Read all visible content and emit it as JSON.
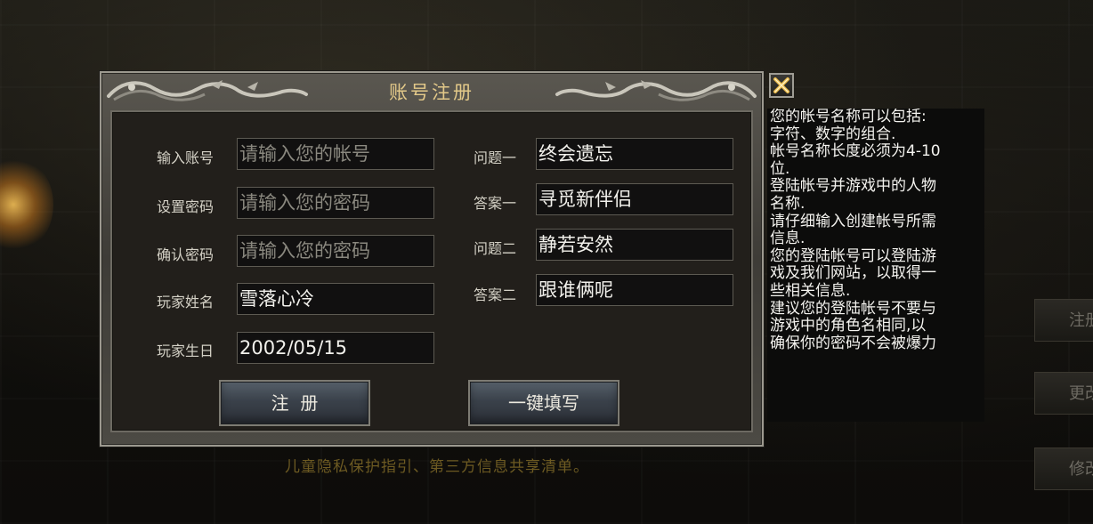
{
  "dialog": {
    "title": "账号注册",
    "left_fields": [
      {
        "label": "输入账号",
        "value": "",
        "placeholder": "请输入您的帐号"
      },
      {
        "label": "设置密码",
        "value": "",
        "placeholder": "请输入您的密码"
      },
      {
        "label": "确认密码",
        "value": "",
        "placeholder": "请输入您的密码"
      },
      {
        "label": "玩家姓名",
        "value": "雪落心冷",
        "placeholder": ""
      },
      {
        "label": "玩家生日",
        "value": "2002/05/15",
        "placeholder": ""
      }
    ],
    "right_fields": [
      {
        "label": "问题一",
        "value": "终会遗忘"
      },
      {
        "label": "答案一",
        "value": "寻觅新伴侣"
      },
      {
        "label": "问题二",
        "value": "静若安然"
      },
      {
        "label": "答案二",
        "value": "跟谁俩呢"
      }
    ],
    "register_button": "注  册",
    "autofill_button": "一键填写"
  },
  "close_icon": "close-x-icon",
  "help_text": [
    "您的帐号名称可以包括:",
    "字符、数字的组合.",
    "帐号名称长度必须为4-10",
    "位.",
    "登陆帐号并游戏中的人物",
    "名称.",
    "请仔细输入创建帐号所需",
    "信息.",
    "您的登陆帐号可以登陆游",
    "戏及我们网站，以取得一",
    "些相关信息.",
    "建议您的登陆帐号不要与",
    "游戏中的角色名相同,以",
    "确保你的密码不会被爆力"
  ],
  "background": {
    "privacy_text": "儿童隐私保护指引、第三方信息共享清单。",
    "side_buttons": [
      "注册",
      "更改",
      "修改"
    ]
  },
  "colors": {
    "title_gold": "#e3c989",
    "panel_dark": "#221f1b",
    "input_bg": "#111010"
  }
}
